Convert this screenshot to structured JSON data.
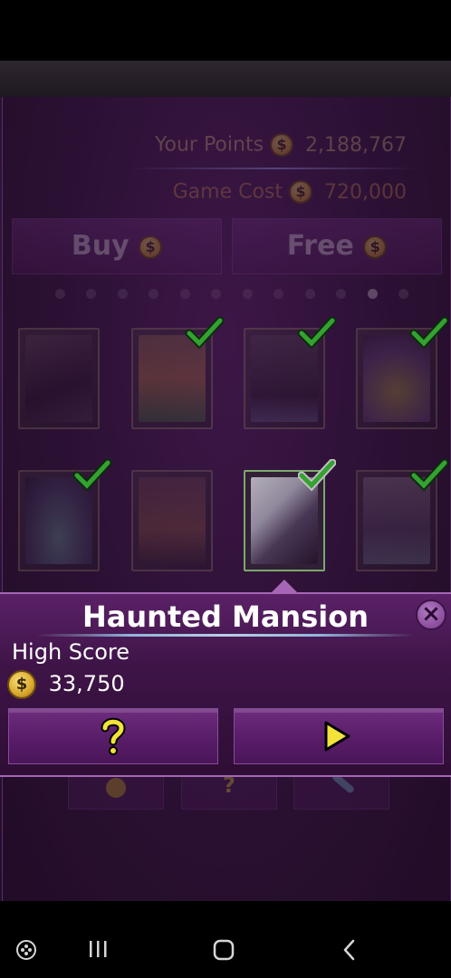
{
  "header": {
    "your_points_label": "Your Points",
    "your_points_value": "2,188,767",
    "game_cost_label": "Game Cost",
    "game_cost_value": "720,000",
    "coin_symbol": "$"
  },
  "buttons": {
    "buy_label": "Buy",
    "free_label": "Free"
  },
  "pager": {
    "total": 12,
    "active_index": 10
  },
  "tables": [
    {
      "name": "table-1",
      "completed": false
    },
    {
      "name": "table-2",
      "completed": true
    },
    {
      "name": "table-3",
      "completed": true
    },
    {
      "name": "table-4",
      "completed": true
    },
    {
      "name": "table-5",
      "completed": true
    },
    {
      "name": "table-6",
      "completed": false
    },
    {
      "name": "table-7",
      "completed": true,
      "selected": true
    },
    {
      "name": "table-8",
      "completed": true
    }
  ],
  "popup": {
    "title": "Haunted Mansion",
    "high_score_label": "High Score",
    "high_score_value": "33,750",
    "help_icon": "question-icon",
    "play_icon": "play-icon",
    "close_icon": "close-icon"
  },
  "colors": {
    "accent_purple": "#5a1e6a",
    "check_green": "#3fd83a",
    "coin_gold": "#d9a72c"
  },
  "navbar": {
    "recent_icon": "recent-apps-icon",
    "home_icon": "home-icon",
    "back_icon": "back-icon",
    "game_icon": "game-controller-icon"
  }
}
